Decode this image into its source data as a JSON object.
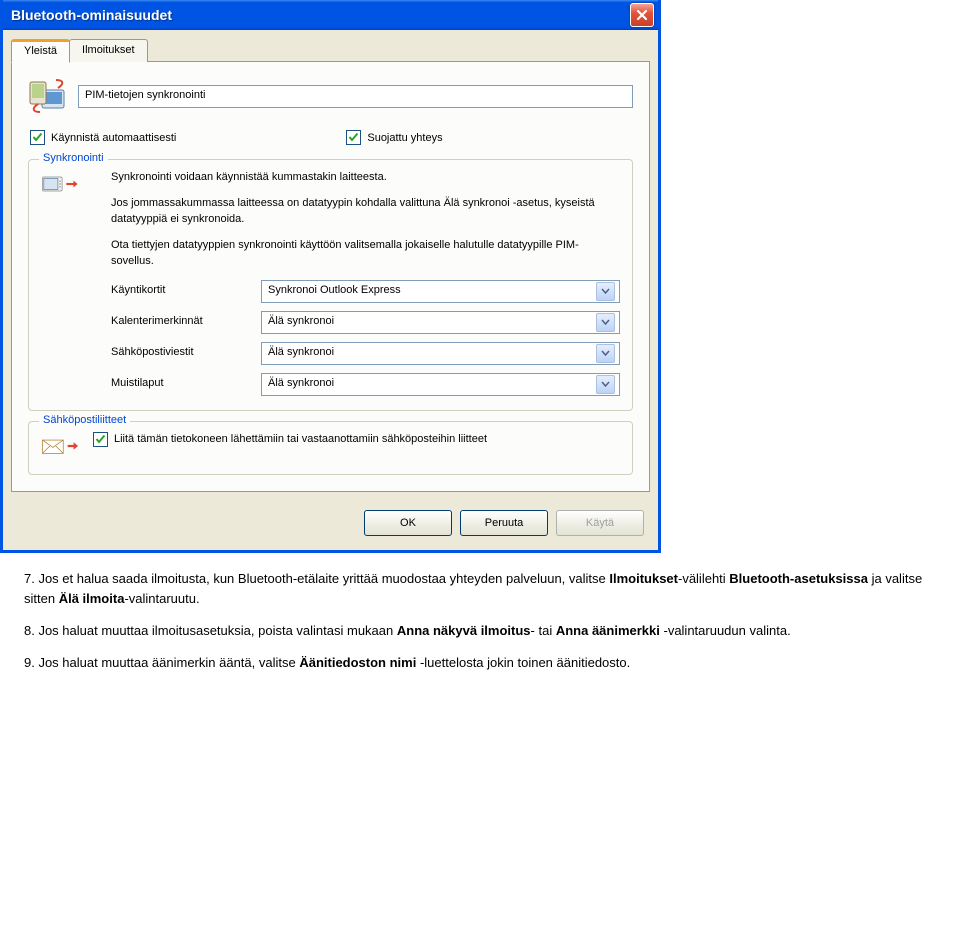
{
  "dialog": {
    "title": "Bluetooth-ominaisuudet",
    "tabs": {
      "general": "Yleistä",
      "notifications": "Ilmoitukset"
    },
    "pim_field_value": "PIM-tietojen synkronointi",
    "cb_auto": "Käynnistä automaattisesti",
    "cb_secure": "Suojattu yhteys",
    "group_sync_legend": "Synkronointi",
    "sync_p1": "Synkronointi voidaan käynnistää kummastakin laitteesta.",
    "sync_p2": "Jos jommassakummassa laitteessa on datatyypin kohdalla valittuna Älä synkronoi -asetus, kyseistä datatyyppiä ei synkronoida.",
    "sync_p3": "Ota tiettyjen datatyyppien synkronointi käyttöön valitsemalla jokaiselle halutulle datatyypille PIM-sovellus.",
    "labels": {
      "cards": "Käyntikortit",
      "calendar": "Kalenterimerkinnät",
      "email": "Sähköpostiviestit",
      "notes": "Muistilaput"
    },
    "values": {
      "cards": "Synkronoi Outlook Express",
      "calendar": "Älä synkronoi",
      "email": "Älä synkronoi",
      "notes": "Älä synkronoi"
    },
    "group_attach_legend": "Sähköpostiliitteet",
    "attach_text": "Liitä tämän tietokoneen lähettämiin tai vastaanottamiin sähköposteihin liitteet",
    "buttons": {
      "ok": "OK",
      "cancel": "Peruuta",
      "apply": "Käytä"
    }
  },
  "doc": {
    "p7a": "7. Jos et halua saada ilmoitusta, kun Bluetooth-etälaite yrittää muodostaa yhteyden palveluun, valitse ",
    "p7b": "Ilmoitukset",
    "p7c": "-välilehti ",
    "p7d": "Bluetooth-asetuksissa",
    "p7e": " ja valitse sitten ",
    "p7f": "Älä ilmoita",
    "p7g": "-valintaruutu.",
    "p8a": "8. Jos haluat muuttaa ilmoitusasetuksia, poista valintasi mukaan ",
    "p8b": "Anna näkyvä ilmoitus",
    "p8c": "- tai ",
    "p8d": "Anna äänimerkki",
    "p8e": " -valintaruudun valinta.",
    "p9a": "9. Jos haluat muuttaa äänimerkin ääntä, valitse ",
    "p9b": "Äänitiedoston nimi",
    "p9c": " -luettelosta jokin toinen äänitiedosto."
  }
}
